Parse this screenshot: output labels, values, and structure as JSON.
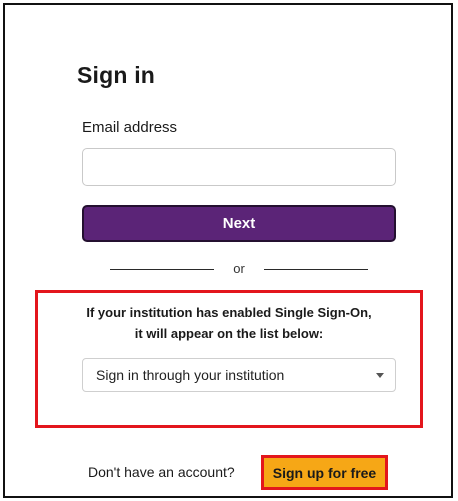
{
  "signin": {
    "title": "Sign in",
    "email_label": "Email address",
    "email_value": "",
    "email_placeholder": "",
    "next_label": "Next"
  },
  "divider": {
    "text": "or"
  },
  "sso": {
    "line1": "If your institution has enabled Single Sign-On,",
    "line2": "it will appear on the list below:",
    "select_value": "Sign in through your institution",
    "highlight_color": "#e3161c"
  },
  "signup": {
    "prompt": "Don't have an account?",
    "button_label": "Sign up for free",
    "button_color": "#f6a716"
  },
  "colors": {
    "primary": "#5b2477",
    "annotation_red": "#e3161c"
  }
}
